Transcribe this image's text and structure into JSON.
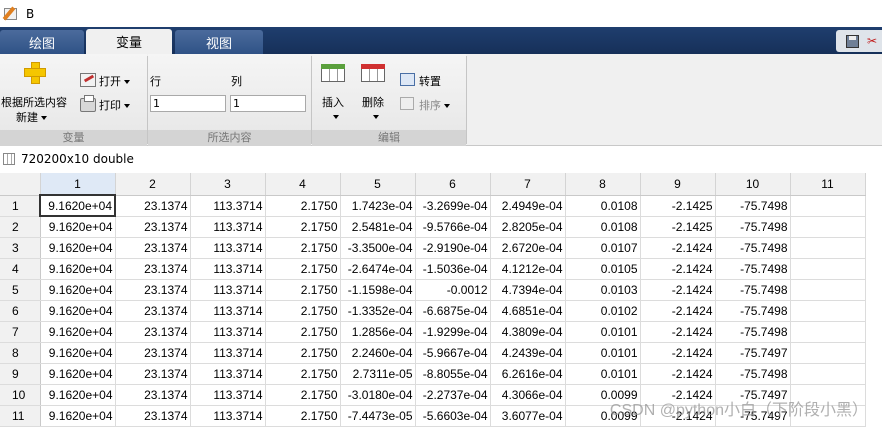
{
  "window": {
    "title": "B"
  },
  "tabs": [
    {
      "label": "绘图",
      "active": false
    },
    {
      "label": "变量",
      "active": true
    },
    {
      "label": "视图",
      "active": false
    }
  ],
  "ribbon": {
    "new_label_line1": "根据所选内容",
    "new_label_line2": "新建",
    "open_label": "打开",
    "print_label": "打印",
    "section_variable": "变量",
    "row_label": "行",
    "col_label": "列",
    "row_value": "1",
    "col_value": "1",
    "section_selection": "所选内容",
    "insert_label": "插入",
    "delete_label": "删除",
    "transpose_label": "转置",
    "sort_label": "排序",
    "section_edit": "编辑"
  },
  "variable": {
    "label": "720200x10 double"
  },
  "table": {
    "columns": [
      "1",
      "2",
      "3",
      "4",
      "5",
      "6",
      "7",
      "8",
      "9",
      "10",
      "11"
    ],
    "rows": [
      {
        "n": "1",
        "cells": [
          "9.1620e+04",
          "23.1374",
          "113.3714",
          "2.1750",
          "1.7423e-04",
          "-3.2699e-04",
          "2.4949e-04",
          "0.0108",
          "-2.1425",
          "-75.7498",
          ""
        ]
      },
      {
        "n": "2",
        "cells": [
          "9.1620e+04",
          "23.1374",
          "113.3714",
          "2.1750",
          "2.5481e-04",
          "-9.5766e-04",
          "2.8205e-04",
          "0.0108",
          "-2.1425",
          "-75.7498",
          ""
        ]
      },
      {
        "n": "3",
        "cells": [
          "9.1620e+04",
          "23.1374",
          "113.3714",
          "2.1750",
          "-3.3500e-04",
          "-2.9190e-04",
          "2.6720e-04",
          "0.0107",
          "-2.1424",
          "-75.7498",
          ""
        ]
      },
      {
        "n": "4",
        "cells": [
          "9.1620e+04",
          "23.1374",
          "113.3714",
          "2.1750",
          "-2.6474e-04",
          "-1.5036e-04",
          "4.1212e-04",
          "0.0105",
          "-2.1424",
          "-75.7498",
          ""
        ]
      },
      {
        "n": "5",
        "cells": [
          "9.1620e+04",
          "23.1374",
          "113.3714",
          "2.1750",
          "-1.1598e-04",
          "-0.0012",
          "4.7394e-04",
          "0.0103",
          "-2.1424",
          "-75.7498",
          ""
        ]
      },
      {
        "n": "6",
        "cells": [
          "9.1620e+04",
          "23.1374",
          "113.3714",
          "2.1750",
          "-1.3352e-04",
          "-6.6875e-04",
          "4.6851e-04",
          "0.0102",
          "-2.1424",
          "-75.7498",
          ""
        ]
      },
      {
        "n": "7",
        "cells": [
          "9.1620e+04",
          "23.1374",
          "113.3714",
          "2.1750",
          "1.2856e-04",
          "-1.9299e-04",
          "4.3809e-04",
          "0.0101",
          "-2.1424",
          "-75.7498",
          ""
        ]
      },
      {
        "n": "8",
        "cells": [
          "9.1620e+04",
          "23.1374",
          "113.3714",
          "2.1750",
          "2.2460e-04",
          "-5.9667e-04",
          "4.2439e-04",
          "0.0101",
          "-2.1424",
          "-75.7497",
          ""
        ]
      },
      {
        "n": "9",
        "cells": [
          "9.1620e+04",
          "23.1374",
          "113.3714",
          "2.1750",
          "2.7311e-05",
          "-8.8055e-04",
          "6.2616e-04",
          "0.0101",
          "-2.1424",
          "-75.7498",
          ""
        ]
      },
      {
        "n": "10",
        "cells": [
          "9.1620e+04",
          "23.1374",
          "113.3714",
          "2.1750",
          "-3.0180e-04",
          "-2.2737e-04",
          "4.3066e-04",
          "0.0099",
          "-2.1424",
          "-75.7497",
          ""
        ]
      },
      {
        "n": "11",
        "cells": [
          "9.1620e+04",
          "23.1374",
          "113.3714",
          "2.1750",
          "-7.4473e-05",
          "-5.6603e-04",
          "3.6077e-04",
          "0.0099",
          "-2.1424",
          "-75.7497",
          ""
        ]
      }
    ]
  },
  "watermark": "CSDN @python小白（下阶段小黑）",
  "colors": {
    "tabstrip": "#1f3e6e",
    "ribbon": "#f0f0f0",
    "selected_header": "#dfe9f6"
  }
}
